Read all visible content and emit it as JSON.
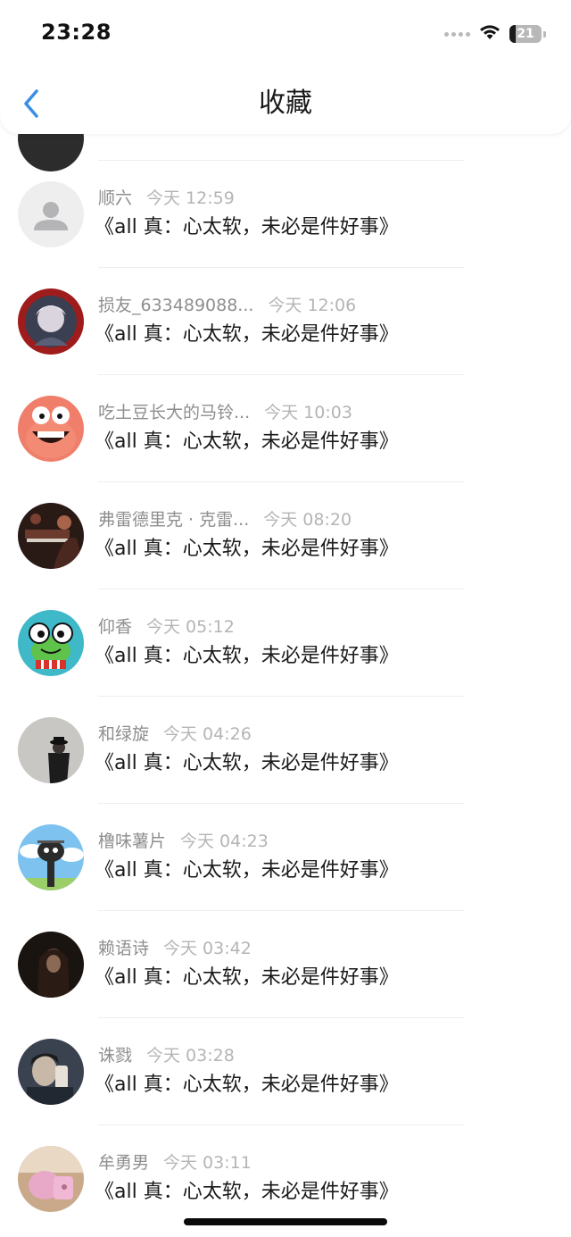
{
  "status_bar": {
    "time": "23:28",
    "battery": "21"
  },
  "nav": {
    "title": "收藏",
    "back_icon": "chevron-left-icon"
  },
  "comments": [
    {
      "name": "顺六",
      "time": "今天 12:59",
      "text": "《all 真：心太软，未必是件好事》",
      "avatar": "default-person"
    },
    {
      "name": "损友_633489088...",
      "time": "今天 12:06",
      "text": "《all 真：心太软，未必是件好事》",
      "avatar": "anime-portrait"
    },
    {
      "name": "吃土豆长大的马铃...",
      "time": "今天 10:03",
      "text": "《all 真：心太软，未必是件好事》",
      "avatar": "patrick-star"
    },
    {
      "name": "弗雷德里克 · 克雷...",
      "time": "今天 08:20",
      "text": "《all 真：心太软，未必是件好事》",
      "avatar": "piano-scene"
    },
    {
      "name": "仰香",
      "time": "今天 05:12",
      "text": "《all 真：心太软，未必是件好事》",
      "avatar": "green-frog"
    },
    {
      "name": "和绿旋",
      "time": "今天 04:26",
      "text": "《all 真：心太软，未必是件好事》",
      "avatar": "person-hat"
    },
    {
      "name": "橹味薯片",
      "time": "今天 04:23",
      "text": "《all 真：心太软，未必是件好事》",
      "avatar": "black-cat-sky"
    },
    {
      "name": "赖语诗",
      "time": "今天 03:42",
      "text": "《all 真：心太软，未必是件好事》",
      "avatar": "dark-portrait"
    },
    {
      "name": "诛戮",
      "time": "今天 03:28",
      "text": "《all 真：心太软，未必是件好事》",
      "avatar": "selfie-phone"
    },
    {
      "name": "牟勇男",
      "time": "今天 03:11",
      "text": "《all 真：心太软，未必是件好事》",
      "avatar": "pink-object"
    }
  ],
  "colors": {
    "accent": "#3a8ee6",
    "name_text": "#8e8e8e",
    "time_text": "#b5b5b5",
    "body_text": "#1a1a1a"
  }
}
